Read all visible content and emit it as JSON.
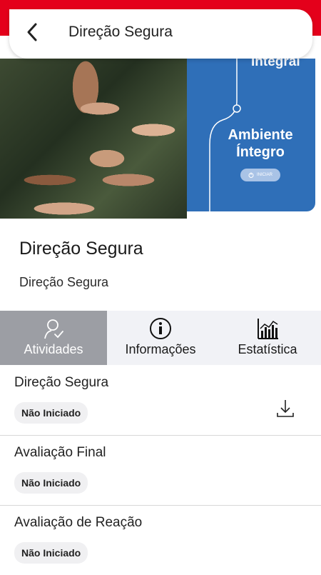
{
  "header": {
    "title": "Direção Segura",
    "back_icon": "chevron-left-icon"
  },
  "hero": {
    "panel_top_text": "Integral",
    "panel_title_line1": "Ambiente",
    "panel_title_line2": "Íntegro",
    "panel_button_label": "INICIAR",
    "panel_color": "#2f6fb8"
  },
  "course": {
    "title": "Direção Segura",
    "subtitle": "Direção Segura"
  },
  "tabs": [
    {
      "label": "Atividades",
      "icon": "user-check-icon",
      "active": true
    },
    {
      "label": "Informações",
      "icon": "info-icon",
      "active": false
    },
    {
      "label": "Estatística",
      "icon": "bar-chart-icon",
      "active": false
    }
  ],
  "activities": [
    {
      "title": "Direção Segura",
      "status": "Não Iniciado",
      "download_icon": "download-icon"
    },
    {
      "title": "Avaliação Final",
      "status": "Não Iniciado"
    },
    {
      "title": "Avaliação de Reação",
      "status": "Não Iniciado"
    }
  ],
  "colors": {
    "brand_red": "#e4001b",
    "active_tab": "#9c9ea4"
  }
}
